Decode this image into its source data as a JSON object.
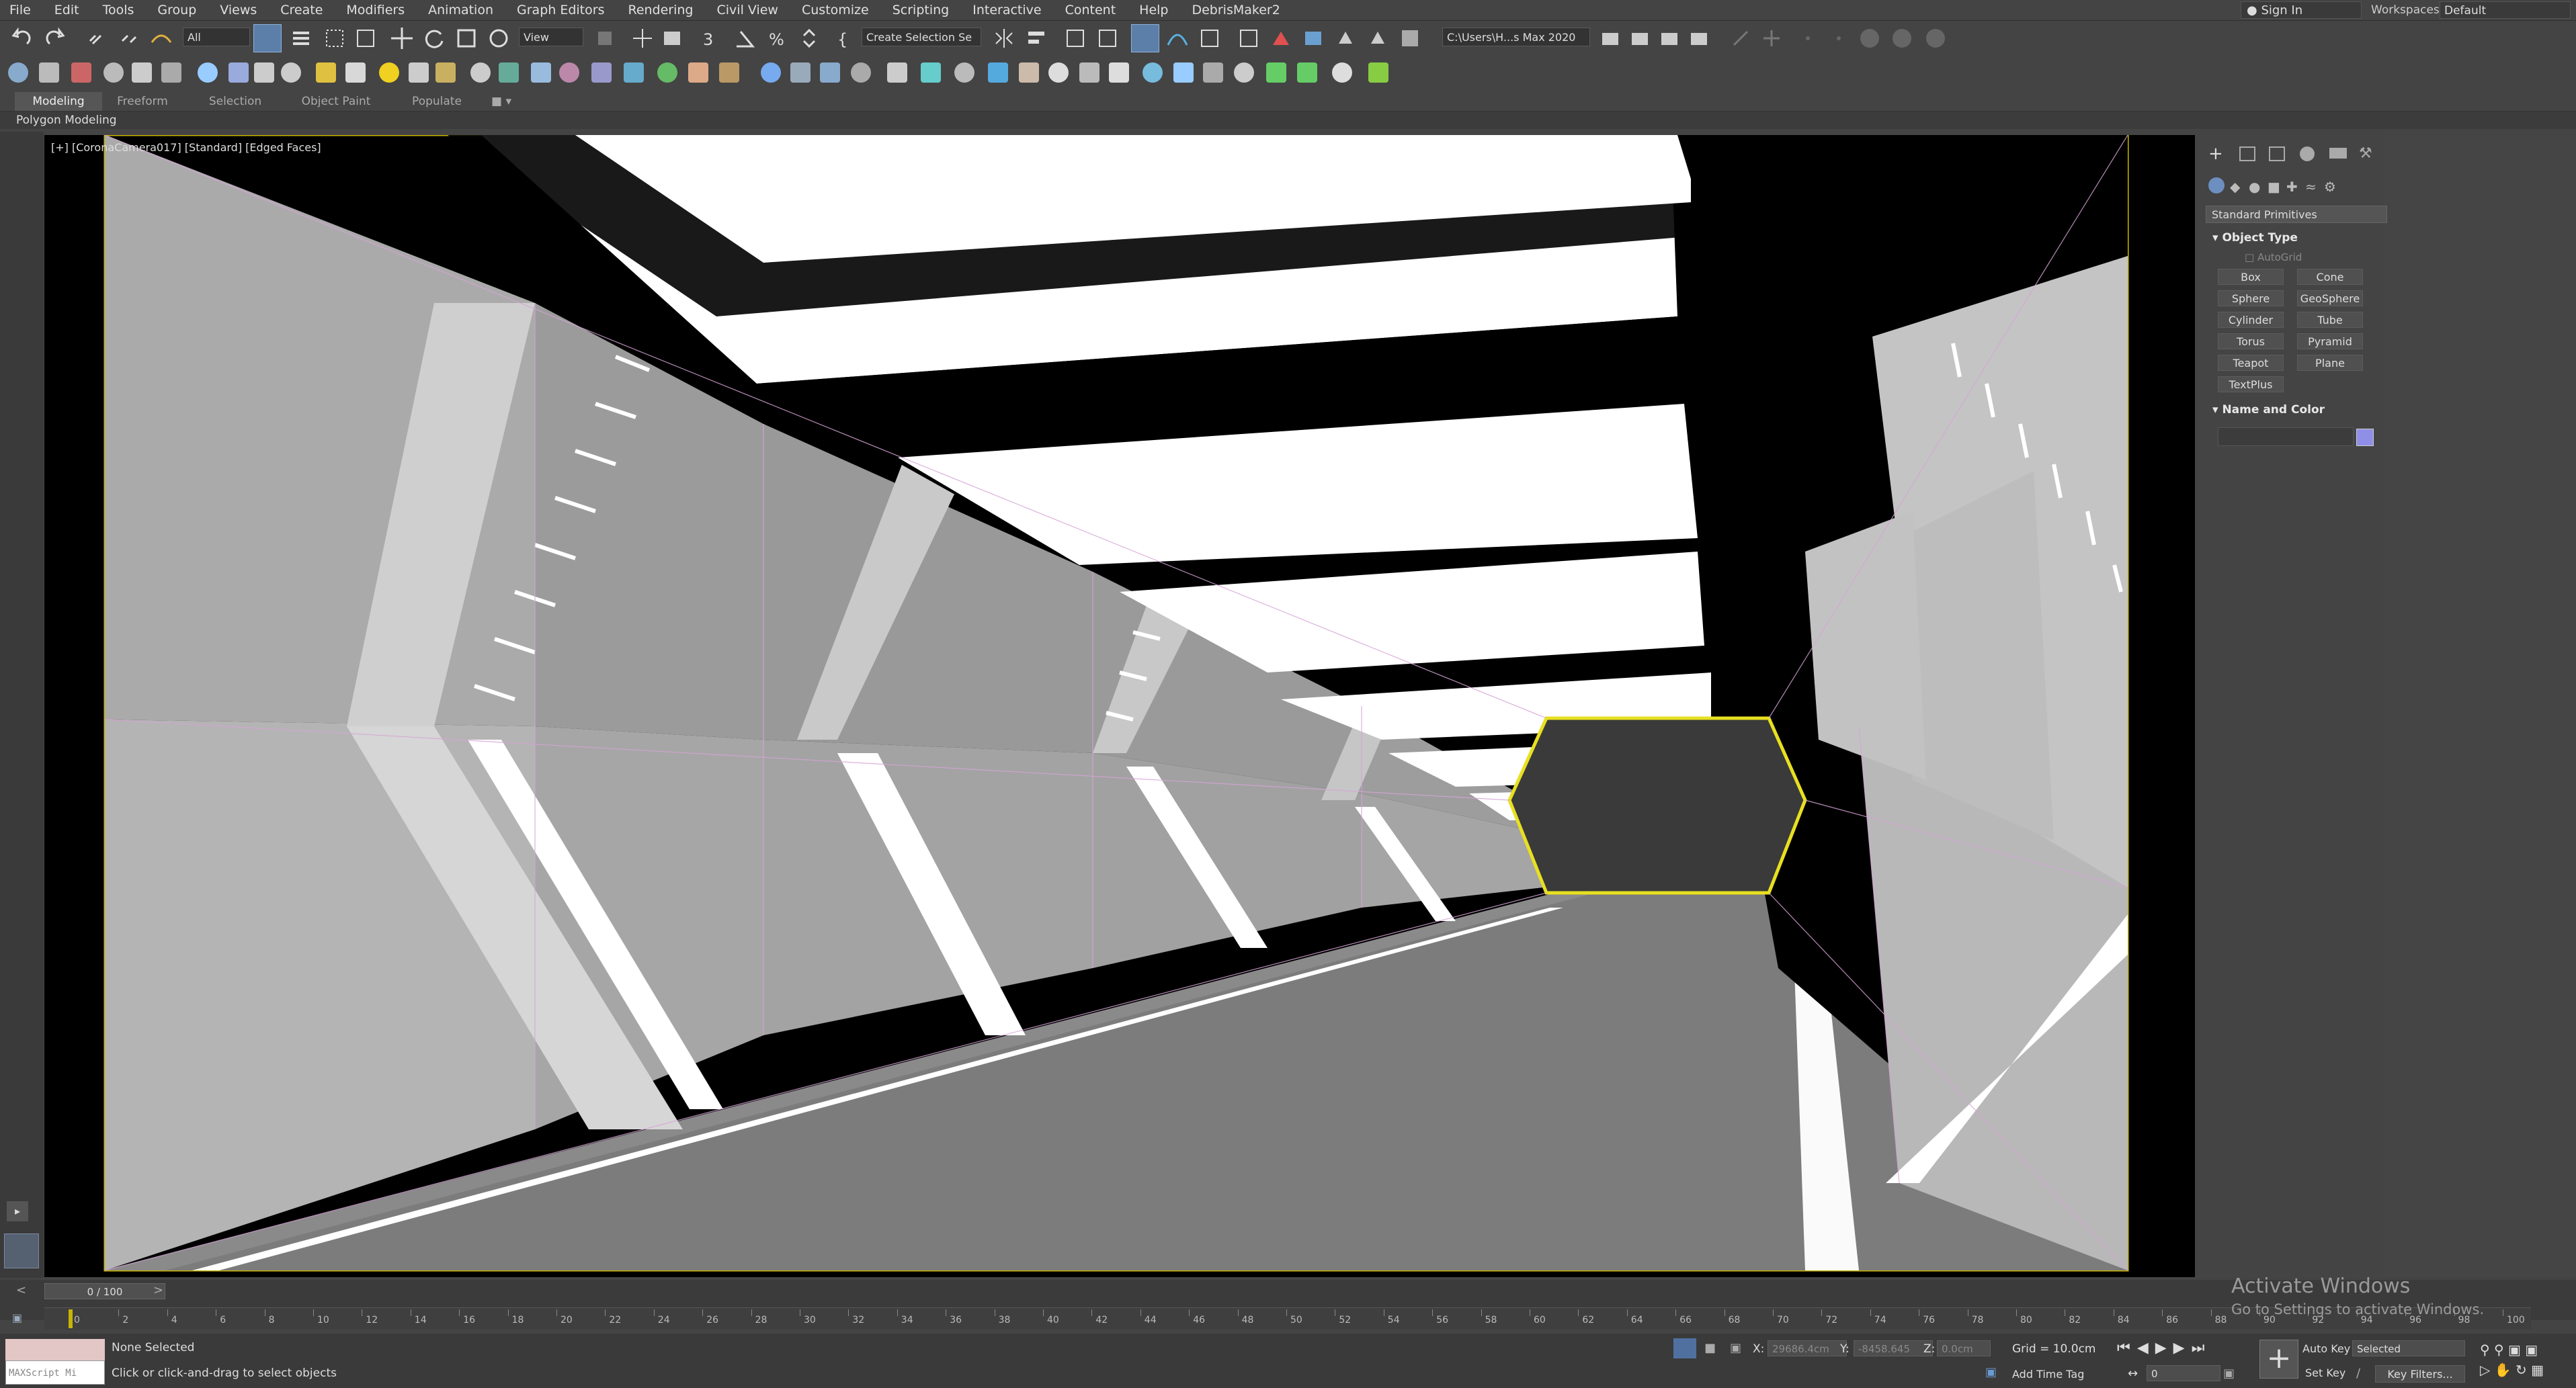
{
  "menu": [
    "File",
    "Edit",
    "Tools",
    "Group",
    "Views",
    "Create",
    "Modifiers",
    "Animation",
    "Graph Editors",
    "Rendering",
    "Civil View",
    "Customize",
    "Scripting",
    "Interactive",
    "Content",
    "Help",
    "DebrisMaker2"
  ],
  "account": {
    "sign_in": "Sign In",
    "workspaces_label": "Workspaces:",
    "workspace": "Default"
  },
  "toolbar": {
    "selection_filter": "All",
    "reference_coord": "View",
    "named_selection": "Create Selection Se",
    "project_path": "C:\\Users\\H...s Max 2020"
  },
  "ribbon": {
    "tabs": [
      "Modeling",
      "Freeform",
      "Selection",
      "Object Paint",
      "Populate"
    ],
    "active": "Modeling",
    "sub_label": "Polygon Modeling"
  },
  "viewport": {
    "label": "[+] [CoronaCamera017] [Standard] [Edged Faces]"
  },
  "command_panel": {
    "dropdown": "Standard Primitives",
    "object_type_header": "Object Type",
    "autogrid": "AutoGrid",
    "buttons": [
      "Box",
      "Cone",
      "Sphere",
      "GeoSphere",
      "Cylinder",
      "Tube",
      "Torus",
      "Pyramid",
      "Teapot",
      "Plane",
      "TextPlus"
    ],
    "name_color_header": "Name and Color",
    "object_color": "#8f8fe8"
  },
  "timeline": {
    "slider": "0 / 100",
    "ticks": [
      "0",
      "2",
      "4",
      "6",
      "8",
      "10",
      "12",
      "14",
      "16",
      "18",
      "20",
      "22",
      "24",
      "26",
      "28",
      "30",
      "32",
      "34",
      "36",
      "38",
      "40",
      "42",
      "44",
      "46",
      "48",
      "50",
      "52",
      "54",
      "56",
      "58",
      "60",
      "62",
      "64",
      "66",
      "68",
      "70",
      "72",
      "74",
      "76",
      "78",
      "80",
      "82",
      "84",
      "86",
      "88",
      "90",
      "92",
      "94",
      "96",
      "98",
      "100"
    ]
  },
  "status": {
    "maxscript": "MAXScript Mi",
    "selection": "None Selected",
    "prompt": "Click or click-and-drag to select objects",
    "x_label": "X:",
    "x_value": "29686.4cm",
    "y_label": "Y:",
    "y_value": "-8458.645",
    "z_label": "Z:",
    "z_value": "0.0cm",
    "grid": "Grid = 10.0cm",
    "add_time_tag": "Add Time Tag",
    "auto_key": "Auto Key",
    "set_key": "Set Key",
    "key_mode": "Selected",
    "key_filters": "Key Filters...",
    "frame": "0"
  },
  "watermark": {
    "line1": "Activate Windows",
    "line2": "Go to Settings to activate Windows."
  }
}
